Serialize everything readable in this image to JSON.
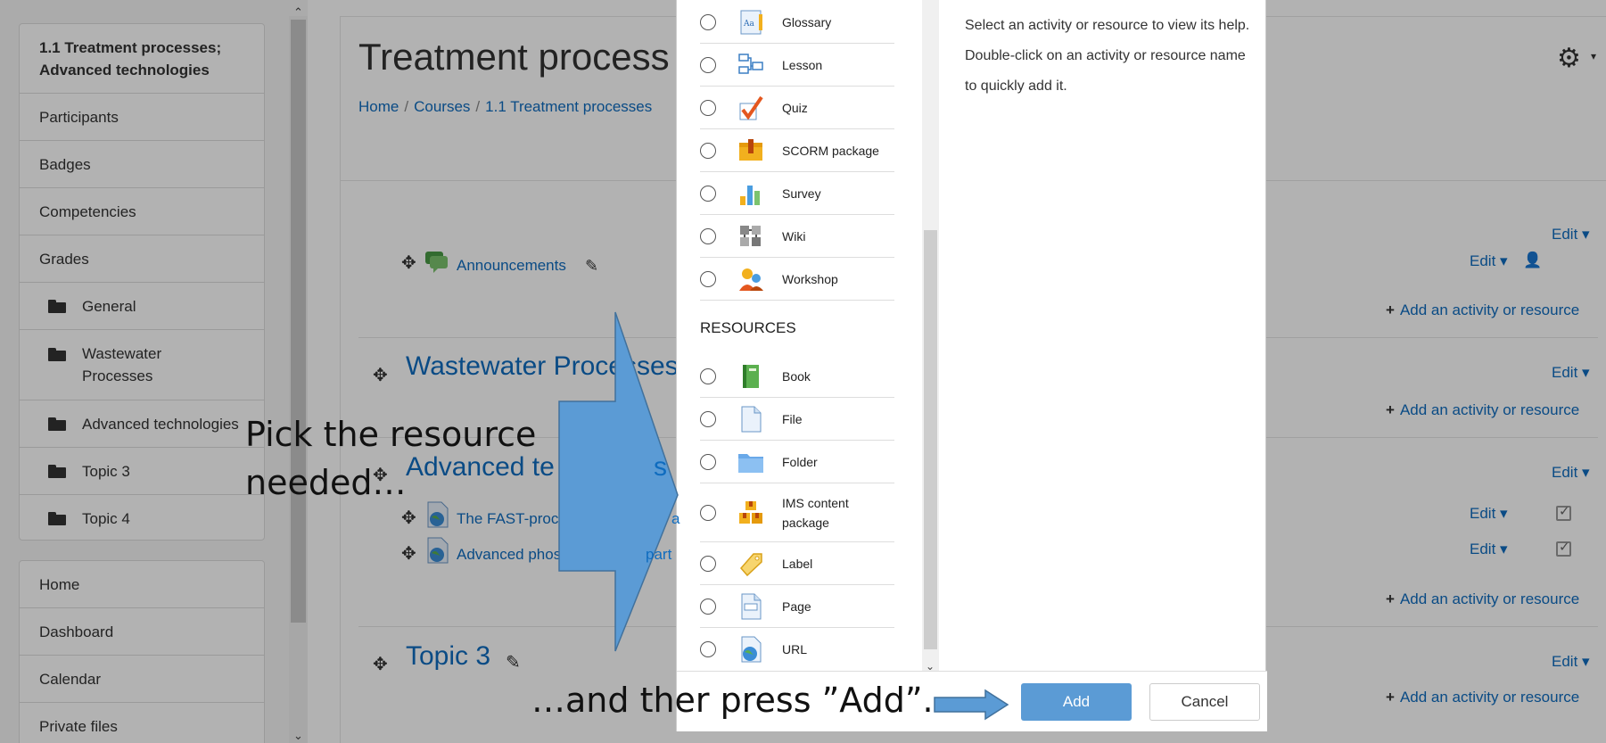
{
  "nav": {
    "course_title": "1.1 Treatment processes; Advanced technologies",
    "items": [
      "Participants",
      "Badges",
      "Competencies",
      "Grades"
    ],
    "sections": [
      "General",
      "Wastewater Processes",
      "Advanced technologies",
      "Topic 3",
      "Topic 4"
    ],
    "site_items": [
      "Home",
      "Dashboard",
      "Calendar",
      "Private files"
    ]
  },
  "page": {
    "title": "Treatment process",
    "breadcrumb": [
      "Home",
      "Courses",
      "1.1 Treatment processes"
    ]
  },
  "course": {
    "announcements": "Announcements",
    "sections": [
      {
        "title": "Wastewater Processes"
      },
      {
        "title": "Advanced te"
      },
      {
        "title": "Topic 3"
      }
    ],
    "activities": [
      "The FAST-proc",
      "Advanced phos"
    ],
    "activity_suffixes": [
      "a",
      "part"
    ],
    "edit_label": "Edit",
    "add_label": "Add an activity or resource"
  },
  "dialog": {
    "activities": [
      "Glossary",
      "Lesson",
      "Quiz",
      "SCORM package",
      "Survey",
      "Wiki",
      "Workshop"
    ],
    "resources_heading": "RESOURCES",
    "resources": [
      "Book",
      "File",
      "Folder",
      "IMS content package",
      "Label",
      "Page",
      "URL"
    ],
    "help_text": "Select an activity or resource to view its help. Double-click on an activity or resource name to quickly add it.",
    "add_label": "Add",
    "cancel_label": "Cancel"
  },
  "callouts": {
    "pick": "Pick the resource needed…",
    "press": "…and ther press ”Add”."
  },
  "colors": {
    "link": "#0f6cbf",
    "callout_arrow": "#5b9bd5",
    "callout_arrow_border": "#41719c",
    "add_button": "#5b9bd5"
  }
}
